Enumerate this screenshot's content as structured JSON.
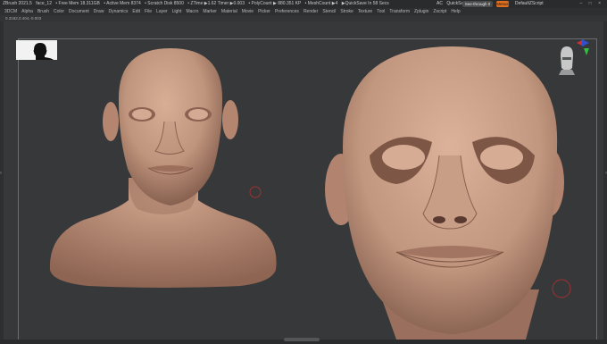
{
  "titlebar": {
    "app": "ZBrush 2021.5",
    "file": "face_12",
    "free_mem": "• Free Mem 18.311GB",
    "active_mem": "• Active Mem 8374",
    "scratch": "• Scratch Disk 8500",
    "ztime": "• ZTime ▶1.62 Timer ▶0.003",
    "polycount": "• PolyCount ▶ 880.351 KP",
    "meshcount": "• MeshCount ▶4",
    "quicksave_info": "▶QuickSave In 58 Secs",
    "ac": "AC",
    "quicksave": "QuickSave",
    "see_through": "See-through 0",
    "menus": "Menus",
    "script": "DefaultZScript",
    "window_controls": "– □ ×"
  },
  "menubar": [
    "3DCM",
    "Alpha",
    "Brush",
    "Color",
    "Document",
    "Draw",
    "Dynamics",
    "Edit",
    "File",
    "Layer",
    "Light",
    "Macro",
    "Marker",
    "Material",
    "Movie",
    "Picker",
    "Preferences",
    "Render",
    "Stencil",
    "Stroke",
    "Texture",
    "Tool",
    "Transform",
    "Zplugin",
    "Zscript",
    "Help"
  ],
  "status": "0.3182,0.404,-0.003",
  "icons": {
    "thumbnail": "silhouette-thumbnail-icon",
    "navigator": "head-navigator-icon",
    "axis": "axis-gizmo-icon",
    "brush_cursor": "brush-cursor-icon"
  },
  "colors": {
    "skin": "#c0957d",
    "background": "#37383a",
    "accent": "#e07020"
  }
}
